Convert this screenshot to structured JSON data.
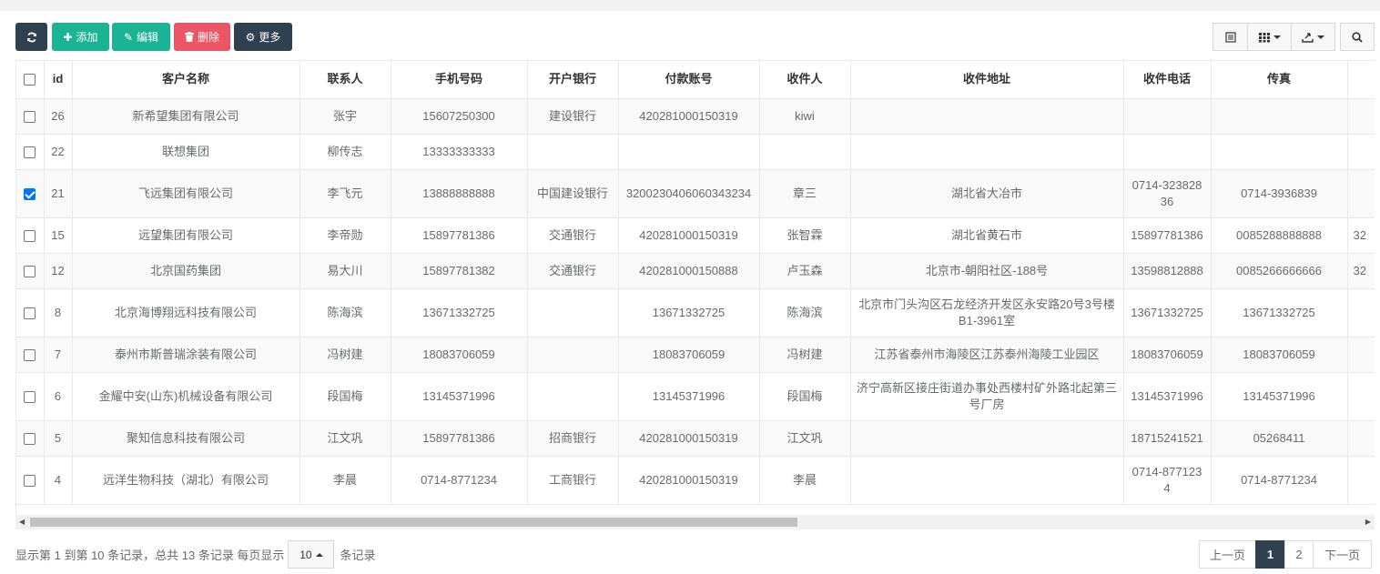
{
  "toolbar": {
    "refresh_icon": "refresh-icon",
    "add_label": "添加",
    "edit_label": "编辑",
    "delete_label": "删除",
    "more_label": "更多"
  },
  "right_tools": {
    "list_icon": "list-icon",
    "columns_icon": "grid-columns-icon",
    "export_icon": "export-icon",
    "search_icon": "search-icon"
  },
  "table": {
    "headers": [
      "id",
      "客户名称",
      "联系人",
      "手机号码",
      "开户银行",
      "付款账号",
      "收件人",
      "收件地址",
      "收件电话",
      "传真"
    ],
    "rows": [
      {
        "checked": false,
        "id": "26",
        "name": "新希望集团有限公司",
        "contact": "张宇",
        "mobile": "15607250300",
        "bank": "建设银行",
        "account": "420281000150319",
        "receiver": "kiwi",
        "address": "",
        "phone": "",
        "fax": "",
        "extra": ""
      },
      {
        "checked": false,
        "id": "22",
        "name": "联想集团",
        "contact": "柳传志",
        "mobile": "13333333333",
        "bank": "",
        "account": "",
        "receiver": "",
        "address": "",
        "phone": "",
        "fax": "",
        "extra": ""
      },
      {
        "checked": true,
        "id": "21",
        "name": "飞远集团有限公司",
        "contact": "李飞元",
        "mobile": "13888888888",
        "bank": "中国建设银行",
        "account": "3200230406060343234",
        "receiver": "章三",
        "address": "湖北省大冶市",
        "phone": "0714-32382836",
        "fax": "0714-3936839",
        "extra": ""
      },
      {
        "checked": false,
        "id": "15",
        "name": "远望集团有限公司",
        "contact": "李帝勋",
        "mobile": "15897781386",
        "bank": "交通银行",
        "account": "420281000150319",
        "receiver": "张智霖",
        "address": "湖北省黄石市",
        "phone": "15897781386",
        "fax": "0085288888888",
        "extra": "32"
      },
      {
        "checked": false,
        "id": "12",
        "name": "北京国药集团",
        "contact": "易大川",
        "mobile": "15897781382",
        "bank": "交通银行",
        "account": "420281000150888",
        "receiver": "卢玉森",
        "address": "北京市-朝阳社区-188号",
        "phone": "13598812888",
        "fax": "0085266666666",
        "extra": "32"
      },
      {
        "checked": false,
        "id": "8",
        "name": "北京海博翔远科技有限公司",
        "contact": "陈海滨",
        "mobile": "13671332725",
        "bank": "",
        "account": "13671332725",
        "receiver": "陈海滨",
        "address": "北京市门头沟区石龙经济开发区永安路20号3号楼B1-3961室",
        "phone": "13671332725",
        "fax": "13671332725",
        "extra": ""
      },
      {
        "checked": false,
        "id": "7",
        "name": "泰州市斯普瑞涂装有限公司",
        "contact": "冯树建",
        "mobile": "18083706059",
        "bank": "",
        "account": "18083706059",
        "receiver": "冯树建",
        "address": "江苏省泰州市海陵区江苏泰州海陵工业园区",
        "phone": "18083706059",
        "fax": "18083706059",
        "extra": ""
      },
      {
        "checked": false,
        "id": "6",
        "name": "金耀中安(山东)机械设备有限公司",
        "contact": "段国梅",
        "mobile": "13145371996",
        "bank": "",
        "account": "13145371996",
        "receiver": "段国梅",
        "address": "济宁高新区接庄街道办事处西楼村矿外路北起第三号厂房",
        "phone": "13145371996",
        "fax": "13145371996",
        "extra": ""
      },
      {
        "checked": false,
        "id": "5",
        "name": "聚知信息科技有限公司",
        "contact": "江文巩",
        "mobile": "15897781386",
        "bank": "招商银行",
        "account": "420281000150319",
        "receiver": "江文巩",
        "address": "",
        "phone": "18715241521",
        "fax": "05268411",
        "extra": ""
      },
      {
        "checked": false,
        "id": "4",
        "name": "远洋生物科技（湖北）有限公司",
        "contact": "李晨",
        "mobile": "0714-8771234",
        "bank": "工商银行",
        "account": "420281000150319",
        "receiver": "李晨",
        "address": "",
        "phone": "0714-8771234",
        "fax": "0714-8771234",
        "extra": ""
      }
    ]
  },
  "pagination": {
    "info_prefix": "显示第 1 到第 10 条记录，总共 13 条记录 每页显示",
    "page_size": "10",
    "info_suffix": "条记录",
    "prev_label": "上一页",
    "pages": [
      "1",
      "2"
    ],
    "next_label": "下一页"
  },
  "colors": {
    "dark": "#2f4050",
    "green": "#1ab394",
    "red": "#ed5565"
  }
}
